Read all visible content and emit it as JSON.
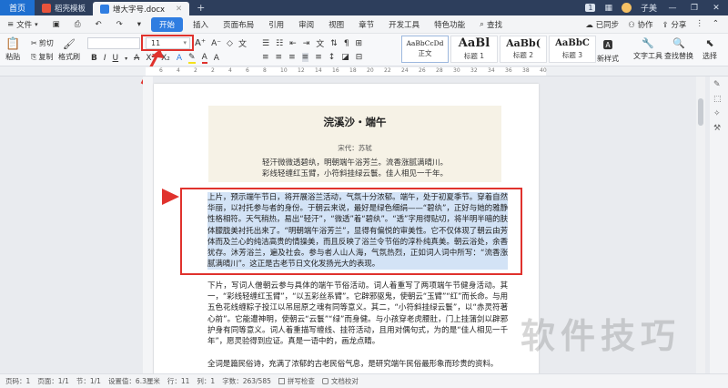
{
  "titlebar": {
    "home": "首页",
    "tabs": [
      {
        "label": "稻壳模板",
        "active": false,
        "icon_color": "#e8533b"
      },
      {
        "label": "增大字号.docx",
        "active": true,
        "icon_color": "#2f7de1"
      }
    ],
    "badge": "1",
    "user": "子美"
  },
  "menubar": {
    "file": "文件",
    "items": [
      "开始",
      "插入",
      "页面布局",
      "引用",
      "审阅",
      "视图",
      "章节",
      "开发工具",
      "特色功能"
    ],
    "search": "查找",
    "right": [
      "已同步",
      "协作",
      "分享"
    ]
  },
  "ribbon": {
    "paste": "粘贴",
    "cut": "剪切",
    "copy": "复制",
    "format_painter": "格式刷",
    "font_size": "11",
    "styles": [
      {
        "sample": "AaBbCcDd",
        "name": "正文"
      },
      {
        "sample": "AaBl",
        "name": "标题 1"
      },
      {
        "sample": "AaBb(",
        "name": "标题 2"
      },
      {
        "sample": "AaBbC",
        "name": "标题 3"
      }
    ],
    "new_style": "新样式",
    "text_tools": "文字工具",
    "find_replace": "查找替换",
    "select": "选择"
  },
  "ruler": {
    "numbers": [
      "6",
      "4",
      "2",
      "2",
      "4",
      "6",
      "8",
      "10",
      "12",
      "14",
      "16",
      "18",
      "20",
      "22",
      "24",
      "26",
      "28",
      "30",
      "32",
      "34",
      "36",
      "38",
      "40"
    ]
  },
  "document": {
    "poem_title": "浣溪沙・端午",
    "poem_author": "宋代：苏轼",
    "poem_line1": "轻汗微微透碧纨，明朝端午浴芳兰。流香涨腻满晴川。",
    "poem_line2": "彩线轻缠红玉臂，小符斜挂绿云鬟。佳人相见一千年。",
    "para_selected": "上片，预示端午节日，将开展浴兰活动，气氛十分浓郁。端午，处于初夏季节。穿着自然华丽，以衬托参与者的身份。于朝云来说，最好是绿色细绢——“碧纨”，正好与她的雅静性格相符。天气稍热，易出“轻汗”，“微透”着“碧纨”。“透”字用得贴切，将半明半暗的肤体朦胧美衬托出来了。“明朝端午浴芳兰”，显得有偏悦的审美性。它不仅体现了朝云由芳体而及兰心的纯洁高贵的情操美，而且反映了浴兰令节俗的淳朴纯真美。朝云浴处，余香犹存。沐芳浴兰，遍及社会。参与者人山人海，气氛热烈，正如词人词中所写：“流香涨腻满晴川”。这正是古老节日文化发扬光大的表现。",
    "para2": "下片，写词人僧朝云参与具体的端午节俗活动。词人着重写了两项端午节健身活动。其一，“彩线轻缠红玉臂”，“以五彩丝系臂”。它辟邪驱鬼，使朝云“玉臂”“红”而长命。与用五色花线缠粽子投江以吊屈原之魂有同等意义。其二，“小符斜挂绿云鬟”，以“赤灵符著心前”。它能遭神明，使朝云“云鬟”“绿”而身健。与小孩穿老虎腰肚，门上挂蒲剑以辟邪护身有同等意义。词人着重描写缠线、挂符活动，且用对偶句式，为的是“佳人相见一千年”，愿灵验得到应证。真是一语中的，画龙点睛。",
    "para3": "全词是篇民俗诗，充满了浓郁的古老民俗气息，是研究端午民俗最形象而珍贵的资料。"
  },
  "watermark": "软件技巧",
  "statusbar": {
    "page_no": "页码：1",
    "pages": "页面：1/1",
    "section": "节：1/1",
    "settings": "设置值：6.3厘米",
    "row": "行：11",
    "col": "列：1",
    "words": "字数：263/585",
    "spell": "拼写检查",
    "proof": "文档校对"
  },
  "colors": {
    "accent": "#2f7de1",
    "highlight_red": "#e0322d",
    "selection": "#d3e3f6",
    "poem_bg": "#f6f2e6"
  }
}
